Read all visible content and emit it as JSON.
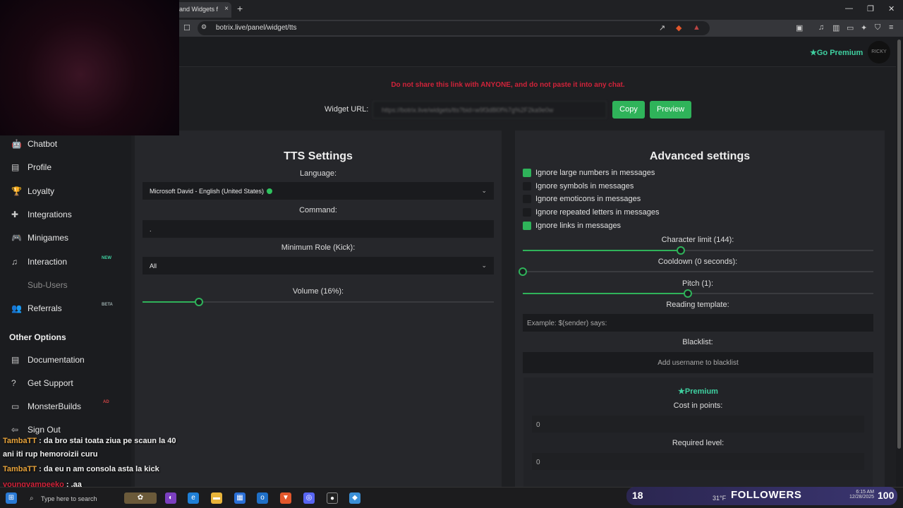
{
  "browser": {
    "tab_title": "and Widgets f",
    "tab_close": "×",
    "new_tab": "+",
    "url": "botrix.live/panel/widget/tts",
    "window_controls": [
      "—",
      "❐",
      "✕"
    ]
  },
  "topbar": {
    "premium_label": "Go Premium",
    "avatar_text": "RICKY"
  },
  "widget": {
    "warning": "Do not share this link with ANYONE, and do not paste it into any chat.",
    "url_label": "Widget URL:",
    "url_value": "https://botrix.live/widgets/tts?bid=w9f3d8l0f%7g%2F2ka9e0w",
    "copy_label": "Copy",
    "preview_label": "Preview"
  },
  "sidebar": {
    "items": [
      {
        "label": "Chatbot",
        "icon": "robot-icon",
        "glyph": "🤖"
      },
      {
        "label": "Profile",
        "icon": "id-card-icon",
        "glyph": "▤"
      },
      {
        "label": "Loyalty",
        "icon": "trophy-icon",
        "glyph": "🏆"
      },
      {
        "label": "Integrations",
        "icon": "puzzle-icon",
        "glyph": "✚"
      },
      {
        "label": "Minigames",
        "icon": "gamepad-icon",
        "glyph": "🎮"
      },
      {
        "label": "Interaction",
        "icon": "music-icon",
        "glyph": "♫",
        "badge": "NEW"
      },
      {
        "label": "Sub-Users",
        "icon": "users-icon",
        "glyph": "",
        "disabled": true
      },
      {
        "label": "Referrals",
        "icon": "referrals-icon",
        "glyph": "👥",
        "badge": "BETA"
      }
    ],
    "other_heading": "Other Options",
    "other_items": [
      {
        "label": "Documentation",
        "icon": "document-icon",
        "glyph": "▤"
      },
      {
        "label": "Get Support",
        "icon": "question-icon",
        "glyph": "?"
      },
      {
        "label": "MonsterBuilds",
        "icon": "laptop-icon",
        "glyph": "▭",
        "badge": "AD"
      },
      {
        "label": "Sign Out",
        "icon": "sign-out-icon",
        "glyph": "⇦"
      }
    ]
  },
  "tts": {
    "title": "TTS Settings",
    "language_label": "Language:",
    "language_value": "Microsoft David - English (United States)",
    "command_label": "Command:",
    "command_value": ".",
    "role_label": "Minimum Role (Kick):",
    "role_value": "All",
    "volume_label": "Volume (16%):",
    "volume_fraction": 0.16
  },
  "advanced": {
    "title": "Advanced settings",
    "checkboxes": [
      {
        "label": "Ignore large numbers in messages",
        "checked": true
      },
      {
        "label": "Ignore symbols in messages",
        "checked": false
      },
      {
        "label": "Ignore emoticons in messages",
        "checked": false
      },
      {
        "label": "Ignore repeated letters in messages",
        "checked": false
      },
      {
        "label": "Ignore links in messages",
        "checked": true
      }
    ],
    "char_limit_label": "Character limit (144):",
    "char_limit_fraction": 0.45,
    "cooldown_label": "Cooldown (0 seconds):",
    "cooldown_fraction": 0,
    "pitch_label": "Pitch (1):",
    "pitch_fraction": 0.47,
    "template_label": "Reading template:",
    "template_placeholder": "Example: $(sender) says:",
    "blacklist_label": "Blacklist:",
    "blacklist_placeholder": "Add username to blacklist",
    "premium_heading": "Premium",
    "cost_label": "Cost in points:",
    "cost_value": "0",
    "level_label": "Required level:",
    "level_value": "0"
  },
  "chat": [
    {
      "user": "TambaTT",
      "text": "da bro stai toata ziua pe scaun la 40"
    },
    {
      "user": "",
      "text": "ani iti rup hemoroizii curu"
    },
    {
      "user": "TambaTT",
      "text": "da eu n am consola asta la kick"
    },
    {
      "user": "youngvampeeko",
      "text": ".aa"
    }
  ],
  "taskbar": {
    "search_placeholder": "Type here to search",
    "followers_count": "18",
    "followers_label": "FOLLOWERS",
    "followers_goal": "100",
    "weather": "31°F",
    "time": "6:15 AM",
    "date": "12/28/2025"
  },
  "colors": {
    "accent": "#2fb35a",
    "warning": "#d0233a",
    "premium": "#3fd0a0",
    "panel": "#26272b"
  }
}
